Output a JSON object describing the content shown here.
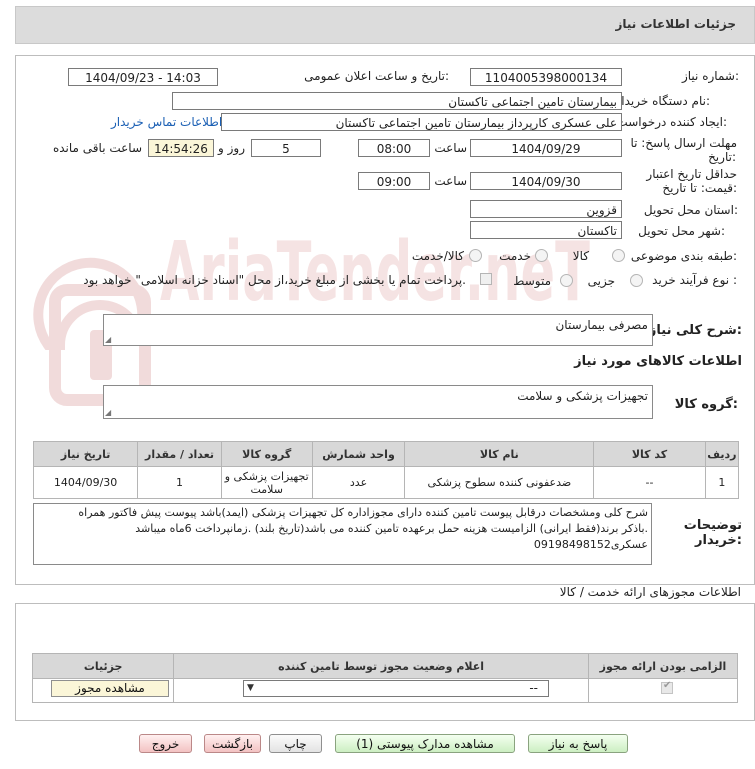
{
  "header": {
    "title": "جزئیات اطلاعات نیاز"
  },
  "fields": {
    "need_number_label": "شماره نیاز:",
    "need_number": "1104005398000134",
    "announce_label": "تاریخ و ساعت اعلان عمومی:",
    "announce_value": "1404/09/23 - 14:03",
    "buyer_label": "نام دستگاه خریدار:",
    "buyer_value": "بیمارستان تامین اجتماعی تاکستان",
    "requester_label": "ایجاد کننده درخواست:",
    "requester_value": "علی عسکری کارپرداز بیمارستان تامین اجتماعی تاکستان",
    "contact_link": "اطلاعات تماس خریدار",
    "deadline_label_1": "مهلت ارسال پاسخ: تا",
    "deadline_label_2": "تاریخ:",
    "deadline_date": "1404/09/29",
    "time_word": "ساعت",
    "deadline_time": "08:00",
    "days_value": "5",
    "days_word": "روز و",
    "remaining_time": "14:54:26",
    "remaining_word": "ساعت باقی مانده",
    "validity_label_1": "حداقل تاریخ اعتبار",
    "validity_label_2": "قیمت: تا تاریخ:",
    "validity_date": "1404/09/30",
    "validity_time": "09:00",
    "province_label": "استان محل تحویل:",
    "province_value": "قزوین",
    "city_label": "شهر محل تحویل:",
    "city_value": "تاکستان",
    "category_label": "طبقه بندی موضوعی:",
    "category_options": [
      "کالا",
      "خدمت",
      "کالا/خدمت"
    ],
    "process_label": "نوع فرآیند خرید :",
    "process_options": [
      "جزیی",
      "متوسط"
    ],
    "payment_note": "پرداخت تمام یا بخشی از مبلغ خرید،از محل \"اسناد خزانه اسلامی\" خواهد بود."
  },
  "summary": {
    "label": "شرح کلی نیاز:",
    "value": "مصرفی بیمارستان"
  },
  "goods_section": {
    "title": "اطلاعات کالاهای مورد نیاز"
  },
  "goods_group": {
    "label": "گروه کالا:",
    "value": "تجهیزات پزشکی و سلامت"
  },
  "items_table": {
    "headers": [
      "ردیف",
      "کد کالا",
      "نام کالا",
      "واحد شمارش",
      "گروه کالا",
      "تعداد / مقدار",
      "تاریخ نیاز"
    ],
    "rows": [
      {
        "row": "1",
        "code": "--",
        "name": "ضدعفونی کننده سطوح پزشکی",
        "unit": "عدد",
        "group": "تجهیزات پزشکی و سلامت",
        "qty": "1",
        "date": "1404/09/30"
      }
    ]
  },
  "buyer_notes": {
    "label_1": "توضیحات",
    "label_2": "خریدار:",
    "line1": "شرح کلی ومشخصات درقابل پیوست تامین کننده دارای مجوزاداره کل تجهیزات پزشکی (ایمد)باشد پیوست پیش فاکتور همراه",
    "line2": "باذکر برند(فقط ایرانی) الزامیست هزینه حمل برعهده تامین کننده می باشد(تاریخ بلند) .زمانپرداخت 6ماه میباشد.",
    "line3": "09198498152عسکری"
  },
  "permits": {
    "title": "اطلاعات مجوزهای ارائه خدمت / کالا",
    "headers": [
      "الزامی بودن ارائه مجوز",
      "اعلام وضعیت مجوز توسط تامین کننده",
      "جزئیات"
    ],
    "select_value": "--",
    "view_button": "مشاهده مجوز"
  },
  "buttons": {
    "reply": "پاسخ به نیاز",
    "attachments": "مشاهده مدارک پیوستی (1)",
    "print": "چاپ",
    "back": "بازگشت",
    "exit": "خروج"
  },
  "watermark": {
    "text": "AriaTender.neT"
  }
}
